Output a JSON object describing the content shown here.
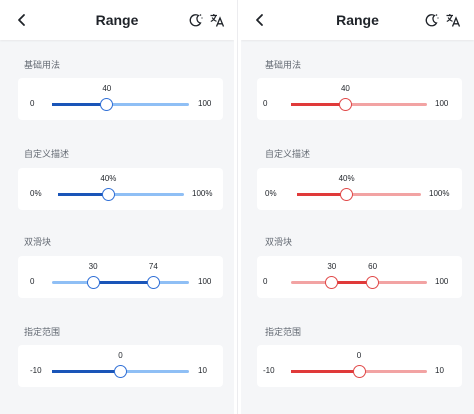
{
  "screens": [
    {
      "header": {
        "title": "Range",
        "back_icon": "chevron-left-icon",
        "theme_icon": "moon-icon",
        "translate_icon": "translate-icon"
      },
      "colors": {
        "track": "#8fbff5",
        "fill": "#1a55b8",
        "thumb_border": "#2f6fd6"
      },
      "sections": [
        {
          "label": "基础用法",
          "min": "0",
          "max": "100",
          "values": [
            "40"
          ],
          "fraction": [
            0,
            0.4
          ]
        },
        {
          "label": "自定义描述",
          "min": "0%",
          "max": "100%",
          "values": [
            "40%"
          ],
          "fraction": [
            0,
            0.4
          ]
        },
        {
          "label": "双滑块",
          "min": "0",
          "max": "100",
          "values": [
            "30",
            "74"
          ],
          "fraction": [
            0.3,
            0.74
          ]
        },
        {
          "label": "指定范围",
          "min": "-10",
          "max": "10",
          "values": [
            "0"
          ],
          "fraction": [
            0,
            0.5
          ]
        }
      ]
    },
    {
      "header": {
        "title": "Range",
        "back_icon": "chevron-left-icon",
        "theme_icon": "moon-icon",
        "translate_icon": "translate-icon"
      },
      "colors": {
        "track": "#f2a3a3",
        "fill": "#e03a3a",
        "thumb_border": "#e04848"
      },
      "sections": [
        {
          "label": "基础用法",
          "min": "0",
          "max": "100",
          "values": [
            "40"
          ],
          "fraction": [
            0,
            0.4
          ]
        },
        {
          "label": "自定义描述",
          "min": "0%",
          "max": "100%",
          "values": [
            "40%"
          ],
          "fraction": [
            0,
            0.4
          ]
        },
        {
          "label": "双滑块",
          "min": "0",
          "max": "100",
          "values": [
            "30",
            "60"
          ],
          "fraction": [
            0.3,
            0.6
          ]
        },
        {
          "label": "指定范围",
          "min": "-10",
          "max": "10",
          "values": [
            "0"
          ],
          "fraction": [
            0,
            0.5
          ]
        }
      ]
    }
  ]
}
